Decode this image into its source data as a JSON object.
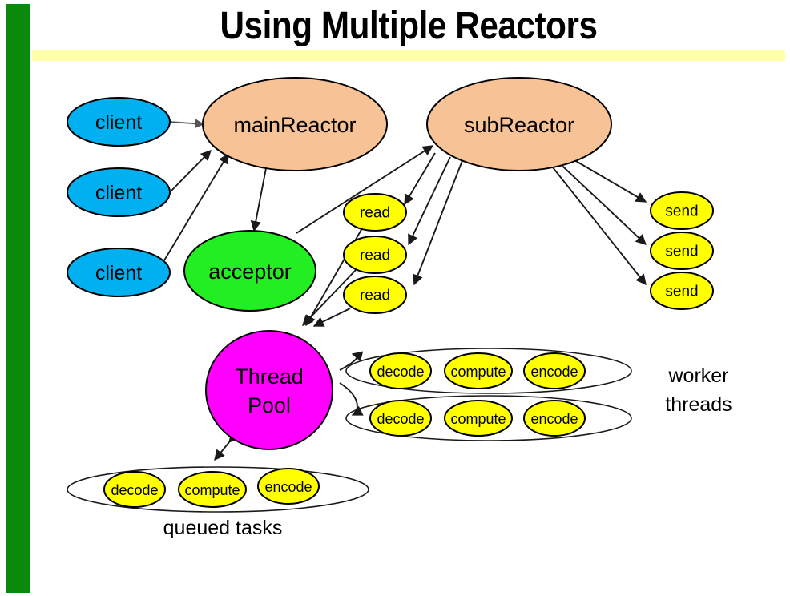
{
  "slide": {
    "title": "Using Multiple Reactors",
    "sidebar_url": "http://gee.cs.oswego.edu",
    "accent_green": "#0a8a0a",
    "accent_yellow_rule": "#ffffaa"
  },
  "colors": {
    "client": "#00b0f0",
    "reactor": "#f7c396",
    "acceptor": "#22ee22",
    "task": "#ffff00",
    "thread_pool": "#ff00ff",
    "outline": "#000000"
  },
  "diagram": {
    "clients": [
      {
        "label": "client"
      },
      {
        "label": "client"
      },
      {
        "label": "client"
      }
    ],
    "main_reactor": {
      "label": "mainReactor"
    },
    "sub_reactor": {
      "label": "subReactor"
    },
    "acceptor": {
      "label": "acceptor"
    },
    "reads": [
      {
        "label": "read"
      },
      {
        "label": "read"
      },
      {
        "label": "read"
      }
    ],
    "sends": [
      {
        "label": "send"
      },
      {
        "label": "send"
      },
      {
        "label": "send"
      }
    ],
    "thread_pool": {
      "label_line1": "Thread",
      "label_line2": "Pool"
    },
    "worker_threads_label_line1": "worker",
    "worker_threads_label_line2": "threads",
    "queued_tasks_label": "queued tasks",
    "worker_rows": [
      {
        "tasks": [
          "decode",
          "compute",
          "encode"
        ]
      },
      {
        "tasks": [
          "decode",
          "compute",
          "encode"
        ]
      }
    ],
    "queued_row": {
      "tasks": [
        "decode",
        "compute",
        "encode"
      ]
    }
  }
}
